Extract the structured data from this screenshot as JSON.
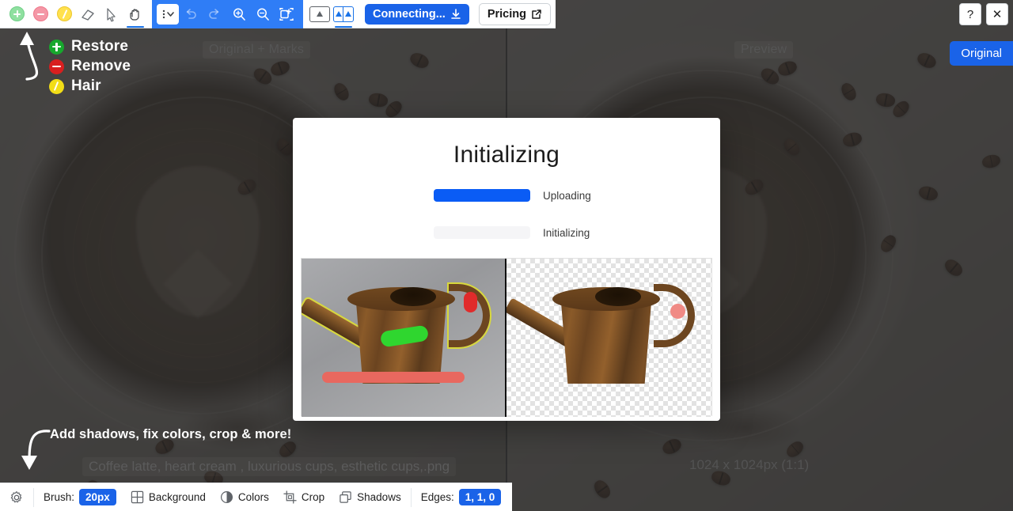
{
  "app": {
    "background_photo_alt": "coffee-latte-heart-art"
  },
  "toolbar": {
    "tools": [
      {
        "name": "restore-brush-tool",
        "icon": "plus-circle-icon",
        "active": false
      },
      {
        "name": "remove-brush-tool",
        "icon": "minus-circle-icon",
        "active": false
      },
      {
        "name": "hair-brush-tool",
        "icon": "slash-circle-icon",
        "active": false
      },
      {
        "name": "eraser-tool",
        "icon": "eraser-icon",
        "active": false
      },
      {
        "name": "cursor-tool",
        "icon": "cursor-arrow-icon",
        "active": false
      },
      {
        "name": "pan-tool",
        "icon": "hand-icon",
        "active": true
      }
    ],
    "menu_label": "⋮",
    "undo_label": "undo-icon",
    "redo_label": "redo-icon",
    "zoom_in_label": "zoom-in-icon",
    "zoom_out_label": "zoom-out-icon",
    "fit_label": "fit-to-screen-icon",
    "single_view_label": "single-view-icon",
    "split_view_label": "split-view-icon",
    "connect_label": "Connecting...",
    "pricing_label": "Pricing"
  },
  "window_controls": {
    "help_label": "?",
    "close_label": "✕",
    "original_label": "Original"
  },
  "legend": {
    "items": [
      {
        "label": "Restore",
        "color": "#17a82d",
        "icon": "plus-circle-icon"
      },
      {
        "label": "Remove",
        "color": "#d81f1f",
        "icon": "minus-circle-icon"
      },
      {
        "label": "Hair",
        "color": "#f2dd17",
        "icon": "slash-circle-icon"
      }
    ]
  },
  "callouts": {
    "bottom_text": "Add shadows, fix colors, crop & more!"
  },
  "canvas": {
    "left_pane_label": "Original + Marks",
    "right_pane_label": "Preview",
    "file_name": "Coffee latte, heart cream , luxurious cups, esthetic cups,.png",
    "dimensions": "1024 x 1024px (1:1)"
  },
  "modal": {
    "title": "Initializing",
    "steps": [
      {
        "label": "Uploading",
        "progress": 100,
        "state": "active"
      },
      {
        "label": "Initializing",
        "progress": 0,
        "state": "pending"
      }
    ],
    "thumbnails": [
      {
        "name": "original-with-marks-thumbnail",
        "caption": ""
      },
      {
        "name": "cutout-preview-thumbnail",
        "caption": ""
      }
    ],
    "accent_color": "#0a5cf5"
  },
  "bottom_toolbar": {
    "settings_label": "settings-gear-icon",
    "brush_label": "Brush:",
    "brush_size": "20px",
    "items": [
      {
        "label": "Background",
        "icon": "grid-icon"
      },
      {
        "label": "Colors",
        "icon": "contrast-circle-icon"
      },
      {
        "label": "Crop",
        "icon": "crop-icon"
      },
      {
        "label": "Shadows",
        "icon": "layers-icon"
      }
    ],
    "edges_label": "Edges:",
    "edges_value": "1, 1, 0"
  },
  "colors": {
    "accent_blue": "#1a63e8",
    "toolbar_blue": "#2f7df6",
    "canvas_bg": "#3d3d3d"
  }
}
